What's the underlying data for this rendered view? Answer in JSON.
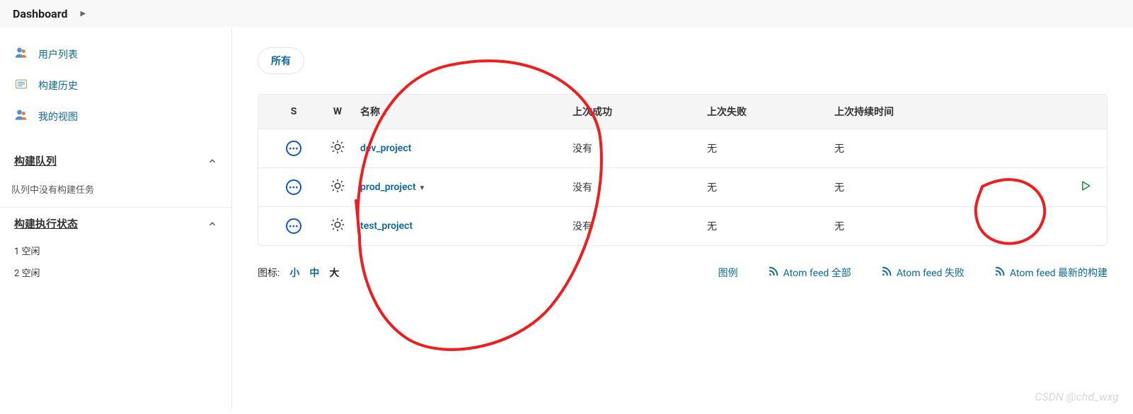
{
  "header": {
    "title": "Dashboard"
  },
  "sidebar": {
    "items": [
      {
        "label": "用户列表"
      },
      {
        "label": "构建历史"
      },
      {
        "label": "我的视图"
      }
    ],
    "queue": {
      "title": "构建队列",
      "empty": "队列中没有构建任务"
    },
    "executor": {
      "title": "构建执行状态",
      "rows": [
        {
          "label": "1  空闲"
        },
        {
          "label": "2  空闲"
        }
      ]
    }
  },
  "tabs": [
    {
      "label": "所有"
    }
  ],
  "table": {
    "headers": {
      "s": "S",
      "w": "W",
      "name": "名称 ↓",
      "lastSuccess": "上次成功",
      "lastFail": "上次失败",
      "lastDuration": "上次持续时间"
    },
    "rows": [
      {
        "name": "dev_project",
        "lastSuccess": "没有",
        "lastFail": "无",
        "lastDuration": "无",
        "hasCaret": false,
        "hasRun": false
      },
      {
        "name": "prod_project",
        "lastSuccess": "没有",
        "lastFail": "无",
        "lastDuration": "无",
        "hasCaret": true,
        "hasRun": true
      },
      {
        "name": "test_project",
        "lastSuccess": "没有",
        "lastFail": "无",
        "lastDuration": "无",
        "hasCaret": false,
        "hasRun": false
      }
    ]
  },
  "footer": {
    "iconLabel": "图标:",
    "sizes": {
      "small": "小",
      "medium": "中",
      "large": "大"
    },
    "legend": "图例",
    "feedAll": "Atom feed 全部",
    "feedFail": "Atom feed 失败",
    "feedLatest": "Atom feed 最新的构建"
  },
  "watermark": "CSDN @chd_wxg"
}
